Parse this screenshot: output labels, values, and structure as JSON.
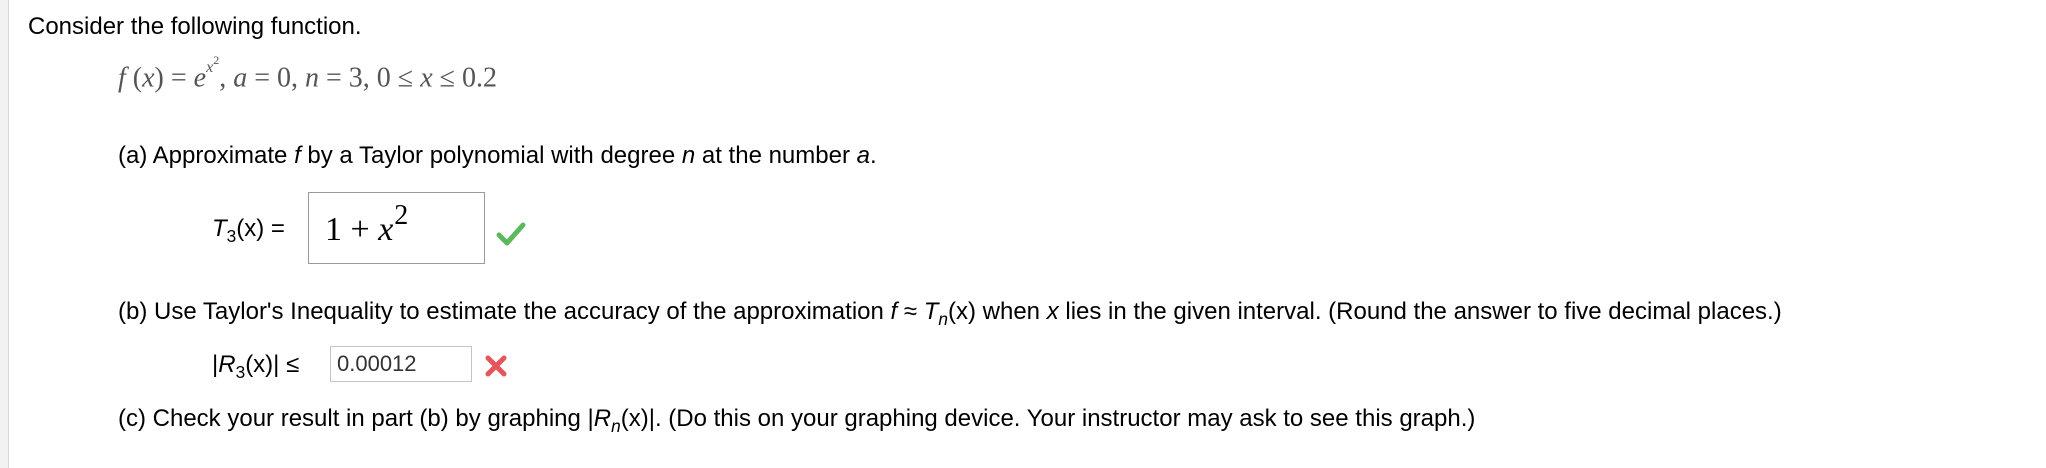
{
  "intro": "Consider the following function.",
  "formula": {
    "f": "f",
    "open": " (",
    "x": "x",
    "close": ") = ",
    "e": "e",
    "exp_base": "x",
    "exp_power": "2",
    "rest1": ", ",
    "a": "a",
    "rest2": " = 0, ",
    "n": "n",
    "rest3": " = 3, 0 ≤ ",
    "x2": "x",
    "rest4": " ≤ 0.2"
  },
  "part_a": {
    "t1": "(a) Approximate ",
    "f": "f",
    "t2": " by a Taylor polynomial with degree ",
    "n": "n",
    "t3": " at the number ",
    "a": "a",
    "t4": "."
  },
  "t3_label": {
    "T": "T",
    "sub": "3",
    "rest": "(x)  ="
  },
  "answer_a": {
    "one_plus": "1 + ",
    "x": "x",
    "power": "2",
    "status": "correct"
  },
  "part_b": {
    "t1": "(b) Use Taylor's Inequality to estimate the accuracy of the approximation ",
    "f": "f",
    "approx": " ≈ ",
    "T": "T",
    "sub": "n",
    "t2": "(x) when ",
    "x": "x",
    "t3": " lies in the given interval. (Round the answer to five decimal places.)"
  },
  "r3_label": {
    "open": "|",
    "R": "R",
    "sub": "3",
    "rest": "(x)|  ≤"
  },
  "answer_b": {
    "value": "0.00012",
    "status": "incorrect"
  },
  "part_c": {
    "t1": "(c) Check your result in part (b) by graphing |",
    "R": "R",
    "sub": "n",
    "t2": "(x)|. (Do this on your graphing device. Your instructor may ask to see this graph.)"
  },
  "colors": {
    "check": "#5cb85c",
    "cross": "#e8545a",
    "formula_text": "#555555",
    "input_border": "#9a9a9a"
  }
}
